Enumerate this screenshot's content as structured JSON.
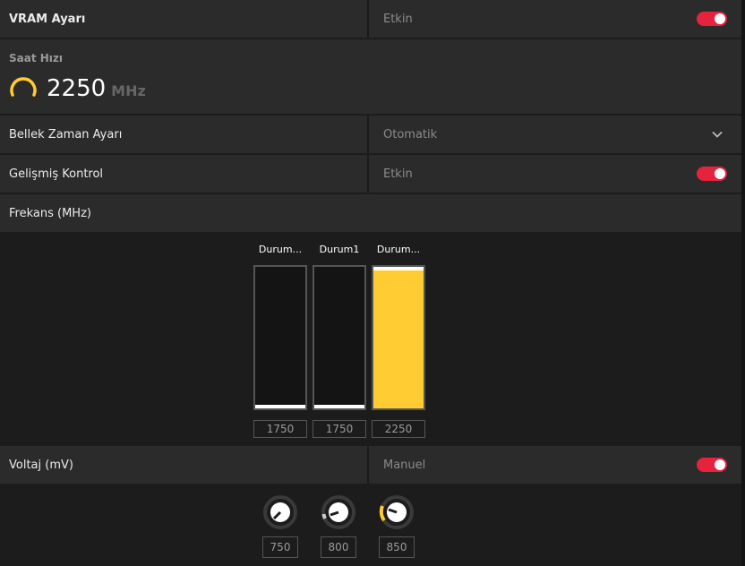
{
  "vram": {
    "label": "VRAM Ayarı",
    "state": "Etkin",
    "on": true
  },
  "clock": {
    "label": "Saat Hızı",
    "value": "2250",
    "unit": "MHz"
  },
  "memory_timing": {
    "label": "Bellek Zaman Ayarı",
    "value": "Otomatik"
  },
  "advanced": {
    "label": "Gelişmiş Kontrol",
    "state": "Etkin",
    "on": true
  },
  "frequency": {
    "label": "Frekans (MHz)",
    "states": [
      {
        "name": "Durum...",
        "value": "1750",
        "level": 0
      },
      {
        "name": "Durum1",
        "value": "1750",
        "level": 0
      },
      {
        "name": "Durum...",
        "value": "2250",
        "level": 1
      }
    ]
  },
  "voltage": {
    "label": "Voltaj (mV)",
    "mode": "Manuel",
    "on": true,
    "states": [
      {
        "value": "750"
      },
      {
        "value": "800"
      },
      {
        "value": "850"
      }
    ]
  },
  "colors": {
    "accent": "#ffcc33",
    "toggle": "#e5233f",
    "panel": "#2b2b2b",
    "bg": "#1c1c1c"
  }
}
